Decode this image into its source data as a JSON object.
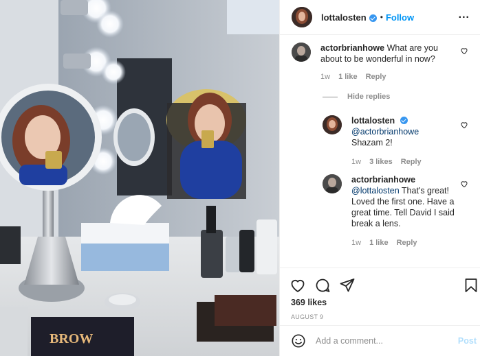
{
  "post": {
    "author": "lottalosten",
    "follow_sep": "•",
    "follow_label": "Follow",
    "more_label": "..."
  },
  "comments": [
    {
      "user": "actorbrianhowe",
      "text": "What are you about to be wonderful in now?",
      "time": "1w",
      "likes": "1 like",
      "reply": "Reply"
    }
  ],
  "hide_replies_label": "Hide replies",
  "replies": [
    {
      "user": "lottalosten",
      "mention": "@actorbrianhowe",
      "text": "Shazam 2!",
      "time": "1w",
      "likes": "3 likes",
      "reply": "Reply"
    },
    {
      "user": "actorbrianhowe",
      "mention": "@lottalosten",
      "text": "That's great! Loved the first one. Have a great time. Tell David I said break a lens.",
      "time": "1w",
      "likes": "1 like",
      "reply": "Reply"
    }
  ],
  "likes_count": "369 likes",
  "date": "AUGUST 9",
  "add_comment": {
    "placeholder": "Add a comment...",
    "post_label": "Post"
  },
  "icons": {
    "like": "heart-icon",
    "comment": "comment-bubble-icon",
    "share": "paper-plane-icon",
    "save": "bookmark-icon",
    "emoji": "smiley-icon",
    "verified": "verified-badge-icon"
  },
  "colors": {
    "accent": "#0095f6",
    "verified": "#3897f0",
    "muted": "#8e8e8e",
    "post_disabled": "#b2dffc"
  }
}
